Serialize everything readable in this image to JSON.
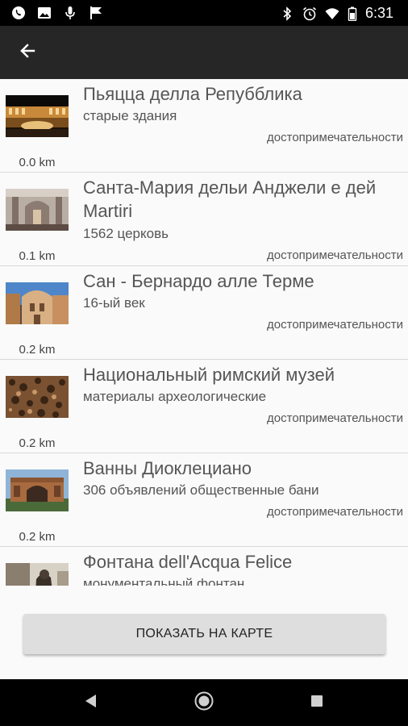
{
  "status_bar": {
    "time": "6:31",
    "left_icons": [
      "whatsapp-icon",
      "image-icon",
      "mic-icon",
      "flag-icon"
    ],
    "right_icons": [
      "bluetooth-icon",
      "alarm-icon",
      "wifi-icon",
      "battery-icon"
    ]
  },
  "app_bar": {
    "back_icon": "arrow-left-icon"
  },
  "places": [
    {
      "title": "Пьяцца делла Репубблика",
      "subtitle": "старые здания",
      "category": "достопримечательности",
      "distance": "0.0 km"
    },
    {
      "title": "Санта-Мария дельи Анджели е дей Martiri",
      "subtitle": "1562 церковь",
      "category": "достопримечательности",
      "distance": "0.1 km"
    },
    {
      "title": "Сан - Бернардо алле Терме",
      "subtitle": "16-ый век",
      "category": "достопримечательности",
      "distance": "0.2 km"
    },
    {
      "title": "Национальный римский музей",
      "subtitle": "материалы археологические",
      "category": "достопримечательности",
      "distance": "0.2 km"
    },
    {
      "title": "Ванны Диоклециано",
      "subtitle": "306 объявлений общественные бани",
      "category": "достопримечательности",
      "distance": "0.2 km"
    },
    {
      "title": "Фонтана dell'Acqua Felice",
      "subtitle": "монументальный фонтан",
      "category": "",
      "distance": ""
    }
  ],
  "show_on_map_button": "ПОКАЗАТЬ НА КАРТЕ",
  "nav_bar": {
    "icons": [
      "back-triangle-icon",
      "home-circle-icon",
      "recents-square-icon"
    ]
  }
}
